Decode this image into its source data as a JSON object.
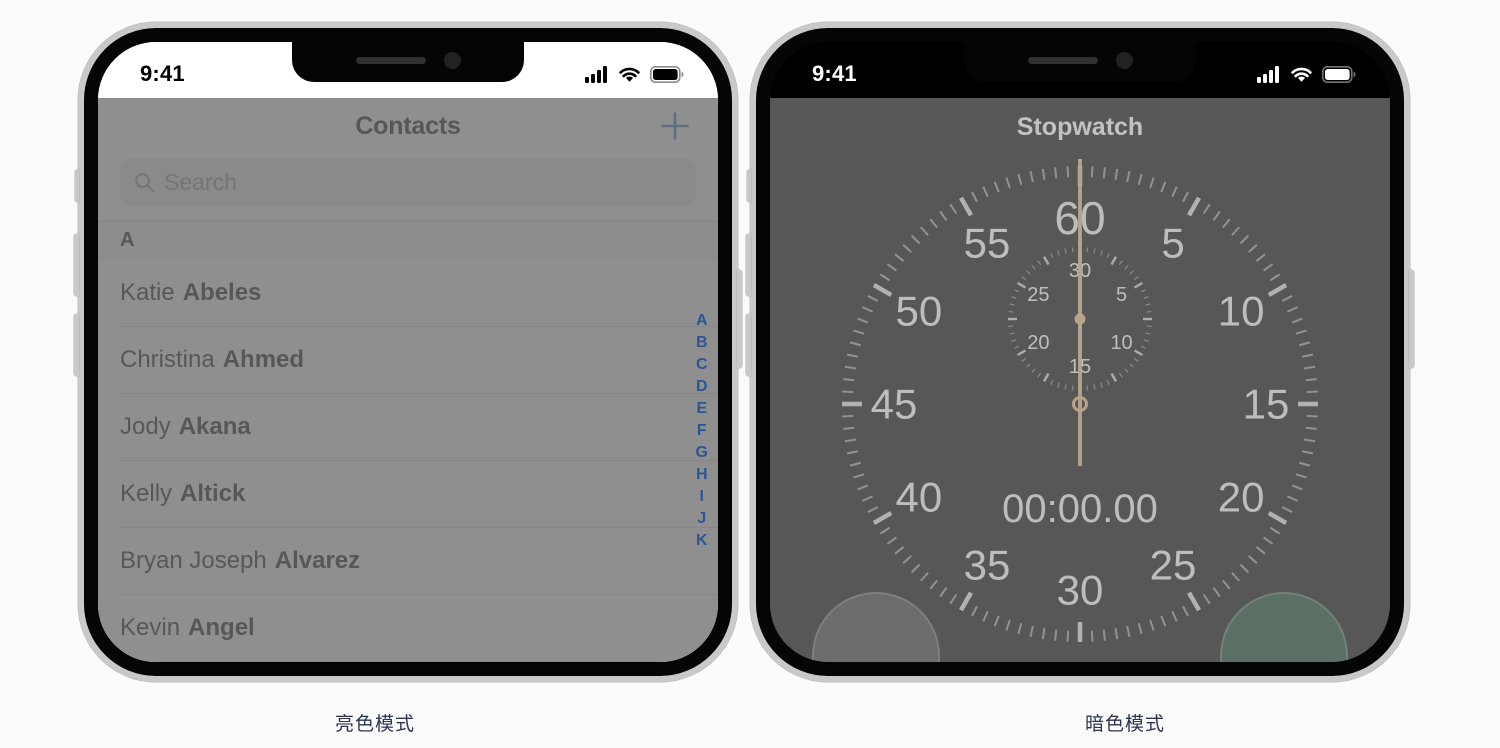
{
  "page": {
    "background_color": "#fbfbfb",
    "caption_color": "#2b3550"
  },
  "panels": [
    {
      "caption": "亮色模式",
      "appearance": "light",
      "statusbar": {
        "time": "9:41",
        "icons": [
          "cellular-signal-icon",
          "wifi-icon",
          "battery-icon"
        ]
      },
      "app": {
        "name": "Contacts",
        "nav": {
          "title": "Contacts",
          "add_button_label": "+",
          "add_button_color": "#1f6bd0"
        },
        "search": {
          "placeholder": "Search",
          "value": "",
          "icon": "search-icon"
        },
        "section_header": "A",
        "contacts": [
          {
            "first": "Katie",
            "last": "Abeles"
          },
          {
            "first": "Christina",
            "last": "Ahmed"
          },
          {
            "first": "Jody",
            "last": "Akana"
          },
          {
            "first": "Kelly",
            "last": "Altick"
          },
          {
            "first": "Bryan Joseph",
            "last": "Alvarez"
          },
          {
            "first": "Kevin",
            "last": "Angel"
          }
        ],
        "index_letters": [
          "A",
          "B",
          "C",
          "D",
          "E",
          "F",
          "G",
          "H",
          "I",
          "J",
          "K"
        ],
        "index_color": "#2c5599"
      }
    },
    {
      "caption": "暗色模式",
      "appearance": "dark",
      "statusbar": {
        "time": "9:41",
        "icons": [
          "cellular-signal-icon",
          "wifi-icon",
          "battery-icon"
        ]
      },
      "app": {
        "name": "Stopwatch",
        "nav": {
          "title": "Stopwatch"
        },
        "elapsed_time": "00:00.00",
        "hand_color": "#e8b87d",
        "main_dial": {
          "labels": [
            "5",
            "10",
            "15",
            "20",
            "25",
            "30",
            "35",
            "40",
            "45",
            "50",
            "55",
            "60"
          ],
          "major_tick_count": 12,
          "minor_tick_count": 120
        },
        "sub_dial": {
          "labels": [
            "5",
            "10",
            "15",
            "20",
            "25",
            "30"
          ],
          "minor_tick_count": 60
        },
        "buttons": [
          {
            "name": "lap",
            "label": "",
            "color": "#333333"
          },
          {
            "name": "start",
            "label": "",
            "color": "#0c3b20"
          }
        ]
      }
    }
  ]
}
